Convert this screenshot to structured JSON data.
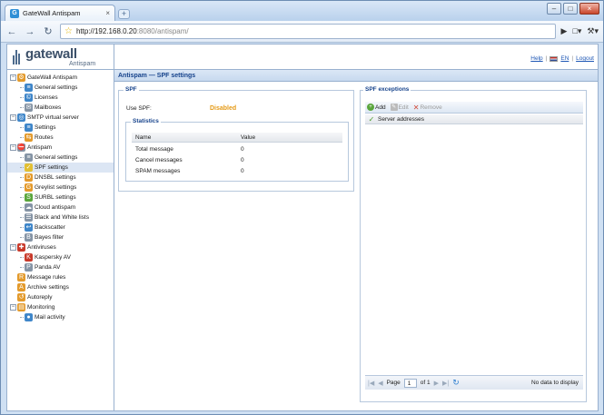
{
  "browser": {
    "tab_title": "GateWall Antispam",
    "tab_close": "×",
    "new_tab": "+",
    "url_main": "http://192.168.0.20",
    "url_rest": ":8080/antispam/",
    "buttons": {
      "minimize": "–",
      "maximize": "□",
      "close": "×"
    }
  },
  "logo": {
    "brand_main": "gatewall",
    "brand_sub": "Antispam"
  },
  "sidebar": {
    "items": [
      {
        "label": "GateWall Antispam",
        "level": 0,
        "toggle": "−",
        "icon": "gear-icon",
        "color": "i-org"
      },
      {
        "label": "General settings",
        "level": 1,
        "icon": "settings-icon",
        "color": "i-blue"
      },
      {
        "label": "Licenses",
        "level": 1,
        "icon": "license-icon",
        "color": "i-blue"
      },
      {
        "label": "Mailboxes",
        "level": 1,
        "icon": "mailbox-icon",
        "color": "i-gray"
      },
      {
        "label": "SMTP virtual server",
        "level": 0,
        "toggle": "−",
        "icon": "globe-icon",
        "color": "i-blue"
      },
      {
        "label": "Settings",
        "level": 1,
        "icon": "settings-icon",
        "color": "i-blue"
      },
      {
        "label": "Routes",
        "level": 1,
        "icon": "routes-icon",
        "color": "i-org"
      },
      {
        "label": "Antispam",
        "level": 0,
        "toggle": "−",
        "icon": "antispam-icon",
        "color": "i-gray"
      },
      {
        "label": "General settings",
        "level": 1,
        "icon": "settings-icon",
        "color": "i-gray"
      },
      {
        "label": "SPF settings",
        "level": 1,
        "icon": "spf-icon",
        "color": "i-yel",
        "selected": true
      },
      {
        "label": "DNSBL settings",
        "level": 1,
        "icon": "dnsbl-icon",
        "color": "i-org"
      },
      {
        "label": "Greylist settings",
        "level": 1,
        "icon": "greylist-icon",
        "color": "i-org"
      },
      {
        "label": "SURBL settings",
        "level": 1,
        "icon": "surbl-icon",
        "color": "i-green"
      },
      {
        "label": "Cloud antispam",
        "level": 1,
        "icon": "cloud-icon",
        "color": "i-gray"
      },
      {
        "label": "Black and White lists",
        "level": 1,
        "icon": "list-icon",
        "color": "i-gray"
      },
      {
        "label": "Backscatter",
        "level": 1,
        "icon": "backscatter-icon",
        "color": "i-blue"
      },
      {
        "label": "Bayes filter",
        "level": 1,
        "icon": "bayes-icon",
        "color": "i-gray"
      },
      {
        "label": "Antiviruses",
        "level": 0,
        "toggle": "−",
        "icon": "antivirus-icon",
        "color": "i-red"
      },
      {
        "label": "Kaspersky AV",
        "level": 1,
        "icon": "kaspersky-icon",
        "color": "i-red"
      },
      {
        "label": "Panda AV",
        "level": 1,
        "icon": "panda-icon",
        "color": "i-gray"
      },
      {
        "label": "Message rules",
        "level": 0,
        "icon": "rules-icon",
        "color": "i-org"
      },
      {
        "label": "Archive settings",
        "level": 0,
        "icon": "archive-icon",
        "color": "i-org"
      },
      {
        "label": "Autoreply",
        "level": 0,
        "icon": "autoreply-icon",
        "color": "i-org"
      },
      {
        "label": "Monitoring",
        "level": 0,
        "toggle": "−",
        "icon": "monitoring-icon",
        "color": "i-org"
      },
      {
        "label": "Mail activity",
        "level": 1,
        "icon": "activity-icon",
        "color": "i-blue"
      }
    ]
  },
  "top_links": {
    "help": "Help",
    "lang": "EN",
    "logout": "Logout",
    "sep": "|"
  },
  "page": {
    "section_title": "Antispam — SPF settings",
    "spf_legend": "SPF",
    "use_spf_label": "Use SPF:",
    "use_spf_value": "Disabled",
    "stats_legend": "Statistics",
    "stats_columns": {
      "name": "Name",
      "value": "Value"
    },
    "stats_rows": [
      {
        "name": "Total message",
        "value": "0"
      },
      {
        "name": "Cancel messages",
        "value": "0"
      },
      {
        "name": "SPAM messages",
        "value": "0"
      }
    ]
  },
  "exceptions": {
    "legend": "SPF exceptions",
    "add": "Add",
    "edit": "Edit",
    "remove": "Remove",
    "column": "Server addresses",
    "pager_page": "Page",
    "pager_current": "1",
    "pager_of": "of 1",
    "empty_msg": "No data to display"
  },
  "colors": {
    "accent": "#15428b",
    "status_disabled": "#e59a16"
  }
}
